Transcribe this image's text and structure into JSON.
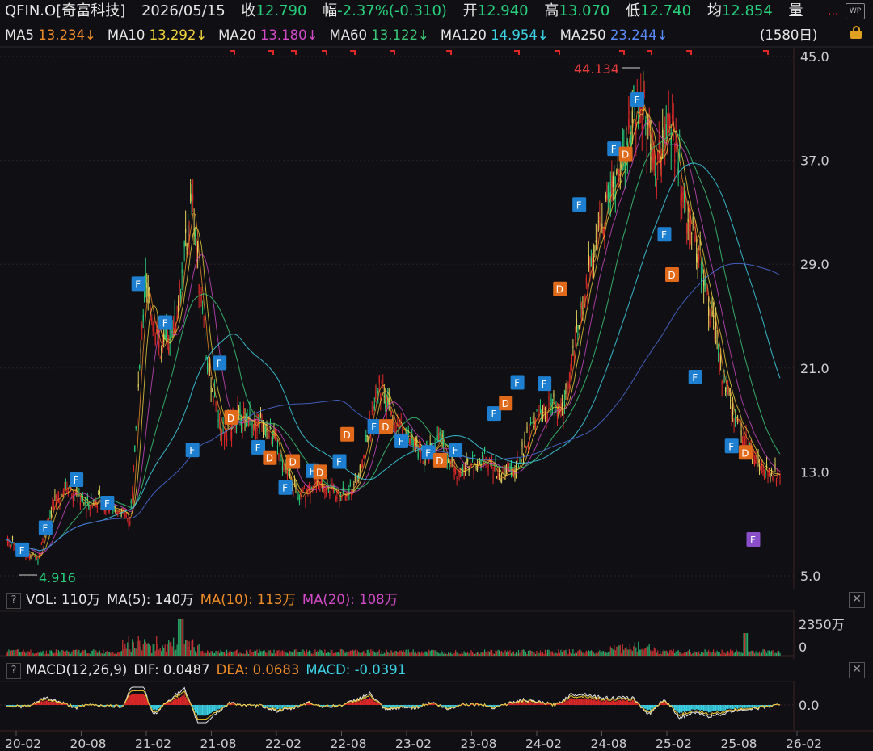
{
  "header": {
    "code": "QFIN.O[奇富科技]",
    "date": "2026/05/15",
    "close_label": "收",
    "close": "12.790",
    "change_label": "幅",
    "change": "-2.37%(-0.310)",
    "open_label": "开",
    "open": "12.940",
    "high_label": "高",
    "high": "13.070",
    "low_label": "低",
    "low": "12.740",
    "avg_label": "均",
    "avg": "12.854",
    "vol_label": "量",
    "more": "...",
    "wp_icon": "WP"
  },
  "ma_bar": {
    "items": [
      {
        "label": "MA5",
        "value": "13.234↓",
        "color": "#f08c28"
      },
      {
        "label": "MA10",
        "value": "13.292↓",
        "color": "#f0d23c"
      },
      {
        "label": "MA20",
        "value": "13.180↓",
        "color": "#d24ac8"
      },
      {
        "label": "MA60",
        "value": "13.122↓",
        "color": "#3cc878"
      },
      {
        "label": "MA120",
        "value": "14.954↓",
        "color": "#3cd2e6"
      },
      {
        "label": "MA250",
        "value": "23.244↓",
        "color": "#5a8cff"
      }
    ],
    "period": "(1580日)"
  },
  "chart_data": [
    {
      "type": "line",
      "title": "",
      "price_axis": {
        "ticks": [
          "45.0",
          "37.0",
          "29.0",
          "21.0",
          "13.0",
          "5.0"
        ],
        "ylim": [
          5.0,
          45.0
        ]
      },
      "x_ticks": [
        "20-02",
        "20-08",
        "21-02",
        "21-08",
        "22-02",
        "22-08",
        "23-02",
        "23-08",
        "24-02",
        "24-08",
        "25-02",
        "25-08",
        "26-02"
      ],
      "price_series_x": [
        0,
        0.02,
        0.04,
        0.06,
        0.08,
        0.1,
        0.12,
        0.14,
        0.16,
        0.18,
        0.2,
        0.22,
        0.24,
        0.26,
        0.28,
        0.3,
        0.32,
        0.34,
        0.36,
        0.38,
        0.4,
        0.42,
        0.44,
        0.46,
        0.48,
        0.5,
        0.52,
        0.54,
        0.56,
        0.58,
        0.6,
        0.62,
        0.64,
        0.66,
        0.68,
        0.7,
        0.72,
        0.74,
        0.76,
        0.78,
        0.8,
        0.82,
        0.84,
        0.86,
        0.88,
        0.9,
        0.92,
        0.94,
        0.96,
        0.98,
        1
      ],
      "price_series_y": [
        7.8,
        7.0,
        6.2,
        10.5,
        12.0,
        10.5,
        10.8,
        10.2,
        9.3,
        28.0,
        22.0,
        25.0,
        34.0,
        21.0,
        16.0,
        17.5,
        17.0,
        16.5,
        13.0,
        11.0,
        12.5,
        11.5,
        11.0,
        13.5,
        20.0,
        17.0,
        15.5,
        14.0,
        15.5,
        13.0,
        13.5,
        14.0,
        12.5,
        13.5,
        16.5,
        18.0,
        18.0,
        24.0,
        30.0,
        34.0,
        38.0,
        42.0,
        36.5,
        40.0,
        33.0,
        28.5,
        22.0,
        17.5,
        15.0,
        13.0,
        12.79
      ],
      "annotations": {
        "max": "44.134",
        "min": "4.916"
      },
      "signals": [
        {
          "label": "F",
          "x": 0.02,
          "y": 7.0,
          "kind": "F"
        },
        {
          "label": "F",
          "x": 0.05,
          "y": 8.7,
          "kind": "F"
        },
        {
          "label": "F",
          "x": 0.09,
          "y": 12.4,
          "kind": "F"
        },
        {
          "label": "F",
          "x": 0.13,
          "y": 10.6,
          "kind": "F"
        },
        {
          "label": "F",
          "x": 0.17,
          "y": 27.5,
          "kind": "F"
        },
        {
          "label": "F",
          "x": 0.205,
          "y": 24.5,
          "kind": "F"
        },
        {
          "label": "F",
          "x": 0.24,
          "y": 14.7,
          "kind": "F"
        },
        {
          "label": "F",
          "x": 0.275,
          "y": 21.4,
          "kind": "F"
        },
        {
          "label": "D",
          "x": 0.29,
          "y": 17.2,
          "kind": "D"
        },
        {
          "label": "F",
          "x": 0.325,
          "y": 14.9,
          "kind": "F"
        },
        {
          "label": "D",
          "x": 0.34,
          "y": 14.1,
          "kind": "D"
        },
        {
          "label": "F",
          "x": 0.36,
          "y": 11.8,
          "kind": "F"
        },
        {
          "label": "D",
          "x": 0.37,
          "y": 13.8,
          "kind": "D"
        },
        {
          "label": "F",
          "x": 0.395,
          "y": 13.1,
          "kind": "F"
        },
        {
          "label": "D",
          "x": 0.405,
          "y": 13.0,
          "kind": "D"
        },
        {
          "label": "F",
          "x": 0.43,
          "y": 13.8,
          "kind": "F"
        },
        {
          "label": "D",
          "x": 0.44,
          "y": 15.9,
          "kind": "D"
        },
        {
          "label": "F",
          "x": 0.475,
          "y": 16.5,
          "kind": "F"
        },
        {
          "label": "D",
          "x": 0.49,
          "y": 16.5,
          "kind": "D"
        },
        {
          "label": "F",
          "x": 0.51,
          "y": 15.4,
          "kind": "F"
        },
        {
          "label": "F",
          "x": 0.545,
          "y": 14.5,
          "kind": "F"
        },
        {
          "label": "D",
          "x": 0.56,
          "y": 13.9,
          "kind": "D"
        },
        {
          "label": "F",
          "x": 0.58,
          "y": 14.7,
          "kind": "F"
        },
        {
          "label": "F",
          "x": 0.63,
          "y": 17.5,
          "kind": "F"
        },
        {
          "label": "D",
          "x": 0.645,
          "y": 18.3,
          "kind": "D"
        },
        {
          "label": "F",
          "x": 0.66,
          "y": 19.9,
          "kind": "F"
        },
        {
          "label": "F",
          "x": 0.695,
          "y": 19.8,
          "kind": "F"
        },
        {
          "label": "D",
          "x": 0.715,
          "y": 27.1,
          "kind": "D"
        },
        {
          "label": "F",
          "x": 0.74,
          "y": 33.6,
          "kind": "F"
        },
        {
          "label": "F",
          "x": 0.785,
          "y": 37.9,
          "kind": "F"
        },
        {
          "label": "D",
          "x": 0.8,
          "y": 37.5,
          "kind": "D"
        },
        {
          "label": "F",
          "x": 0.815,
          "y": 41.7,
          "kind": "F"
        },
        {
          "label": "F",
          "x": 0.85,
          "y": 31.3,
          "kind": "F"
        },
        {
          "label": "D",
          "x": 0.86,
          "y": 28.2,
          "kind": "D"
        },
        {
          "label": "F",
          "x": 0.89,
          "y": 20.3,
          "kind": "F"
        },
        {
          "label": "F",
          "x": 0.937,
          "y": 15.0,
          "kind": "F"
        },
        {
          "label": "D",
          "x": 0.955,
          "y": 14.5,
          "kind": "D"
        },
        {
          "label": "F",
          "x": 0.965,
          "y": 7.8,
          "kind": "P"
        }
      ]
    },
    {
      "type": "bar",
      "title": "",
      "legend": [
        {
          "label": "VOL: 110万",
          "color": "#e6e6e6"
        },
        {
          "label": "MA(5): 140万",
          "color": "#e6e6e6"
        },
        {
          "label": "MA(10): 113万",
          "color": "#f08c28"
        },
        {
          "label": "MA(20): 108万",
          "color": "#d24ac8"
        }
      ],
      "y_ticks": [
        "2350万",
        "0"
      ]
    },
    {
      "type": "bar",
      "title": "",
      "legend": [
        {
          "label": "MACD(12,26,9)",
          "color": "#e6e6e6"
        },
        {
          "label": "DIF: 0.0487",
          "color": "#e6e6e6"
        },
        {
          "label": "DEA: 0.0683",
          "color": "#f08c28"
        },
        {
          "label": "MACD: -0.0391",
          "color": "#3cd2e6"
        }
      ],
      "y_ticks": [
        "0.0"
      ]
    }
  ],
  "colors": {
    "bg": "#101014",
    "grid": "#2a1f1f",
    "up": "#e02828",
    "down": "#26d07c",
    "F_box": "#1e7fd0",
    "D_box": "#e06a1a",
    "P_box": "#8a4fc8"
  },
  "panel_icons": {
    "help": "?",
    "close": "✕"
  }
}
